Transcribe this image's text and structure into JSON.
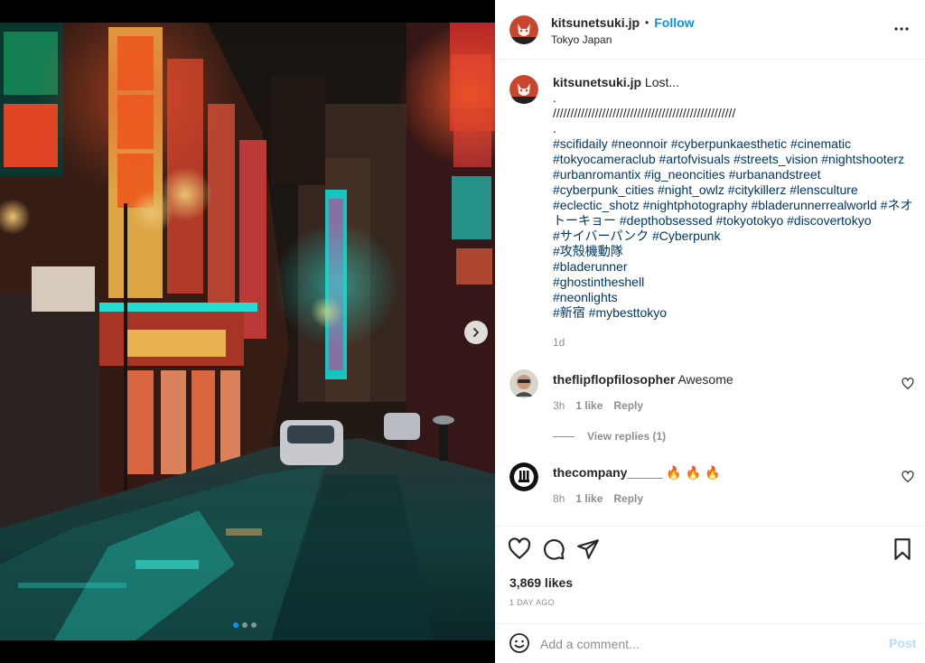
{
  "post": {
    "username": "kitsunetsuki.jp",
    "separator": "•",
    "follow_label": "Follow",
    "location": "Tokyo Japan",
    "image_alt": "Neon-lit rainy street in Shinjuku at night",
    "carousel": {
      "count": 3,
      "active": 0
    }
  },
  "caption": {
    "username": "kitsunetsuki.jp",
    "first_line": "Lost...",
    "lines": [
      ".",
      "////////////////////////////////////////////////////",
      "."
    ],
    "hashtags": [
      "#scifidaily #neonnoir #cyberpunkaesthetic #cinematic",
      "#tokyocameraclub #artofvisuals #streets_vision #nightshooterz",
      "#urbanromantix #ig_neoncities #urbanandstreet",
      "#cyberpunk_cities #night_owlz #citykillerz #lensculture",
      "#eclectic_shotz #nightphotography #bladerunnerrealworld #ネオ",
      "トーキョー #depthobsessed #tokyotokyo #discovertokyo",
      "#サイバーパンク #Cyberpunk",
      "#攻殻機動隊",
      "#bladerunner",
      "#ghostintheshell",
      "#neonlights",
      "#新宿 #mybesttokyo"
    ],
    "time": "1d"
  },
  "comments": [
    {
      "username": "theflipflopfilosopher",
      "text": "Awesome",
      "time": "3h",
      "likes": "1 like",
      "reply_label": "Reply",
      "view_replies": "View replies (1)"
    },
    {
      "username": "thecompany_____",
      "text": "🔥 🔥 🔥",
      "time": "8h",
      "likes": "1 like",
      "reply_label": "Reply"
    }
  ],
  "actions": {
    "likes": "3,869 likes",
    "date": "1 DAY AGO"
  },
  "add_comment": {
    "placeholder": "Add a comment...",
    "post_label": "Post"
  },
  "icons": {
    "more": "more-options-icon",
    "like": "heart-icon",
    "comment": "comment-icon",
    "share": "share-icon",
    "save": "bookmark-icon",
    "emoji": "emoji-icon",
    "next": "chevron-right-icon"
  },
  "colors": {
    "link": "#0095f6",
    "hashtag": "#00376b",
    "muted": "#8e8e8e",
    "post_disabled": "#b2dffc"
  }
}
